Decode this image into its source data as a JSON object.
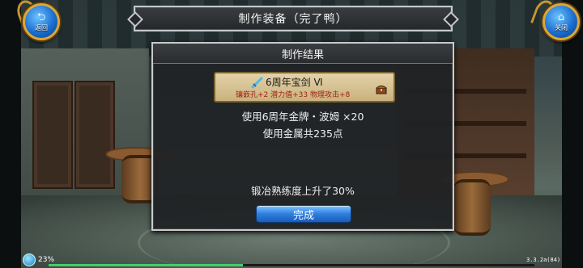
{
  "top_bar": {
    "title": "制作装备（完了鸭）",
    "back_label": "返回",
    "close_label": "关闭"
  },
  "dialog": {
    "title": "制作结果",
    "item": {
      "name": "6周年宝剑 Ⅵ",
      "stats": "镶嵌孔+2  潜力值+33  物理攻击+8",
      "icon": "sword-icon",
      "chest_icon": "treasure-chest-icon"
    },
    "message_used": "使用6周年金牌・波姆  ×20",
    "message_metal": "使用金属共235点",
    "message_skill": "锻冶熟练度上升了30%",
    "confirm_label": "完成"
  },
  "status": {
    "percent": "23%",
    "version": "3.3.2a(84)",
    "exp_fraction": 0.4
  },
  "colors": {
    "button_blue": "#2f7fe0",
    "item_stats_red": "#a11e12",
    "gold_trim": "#d9a83a"
  }
}
